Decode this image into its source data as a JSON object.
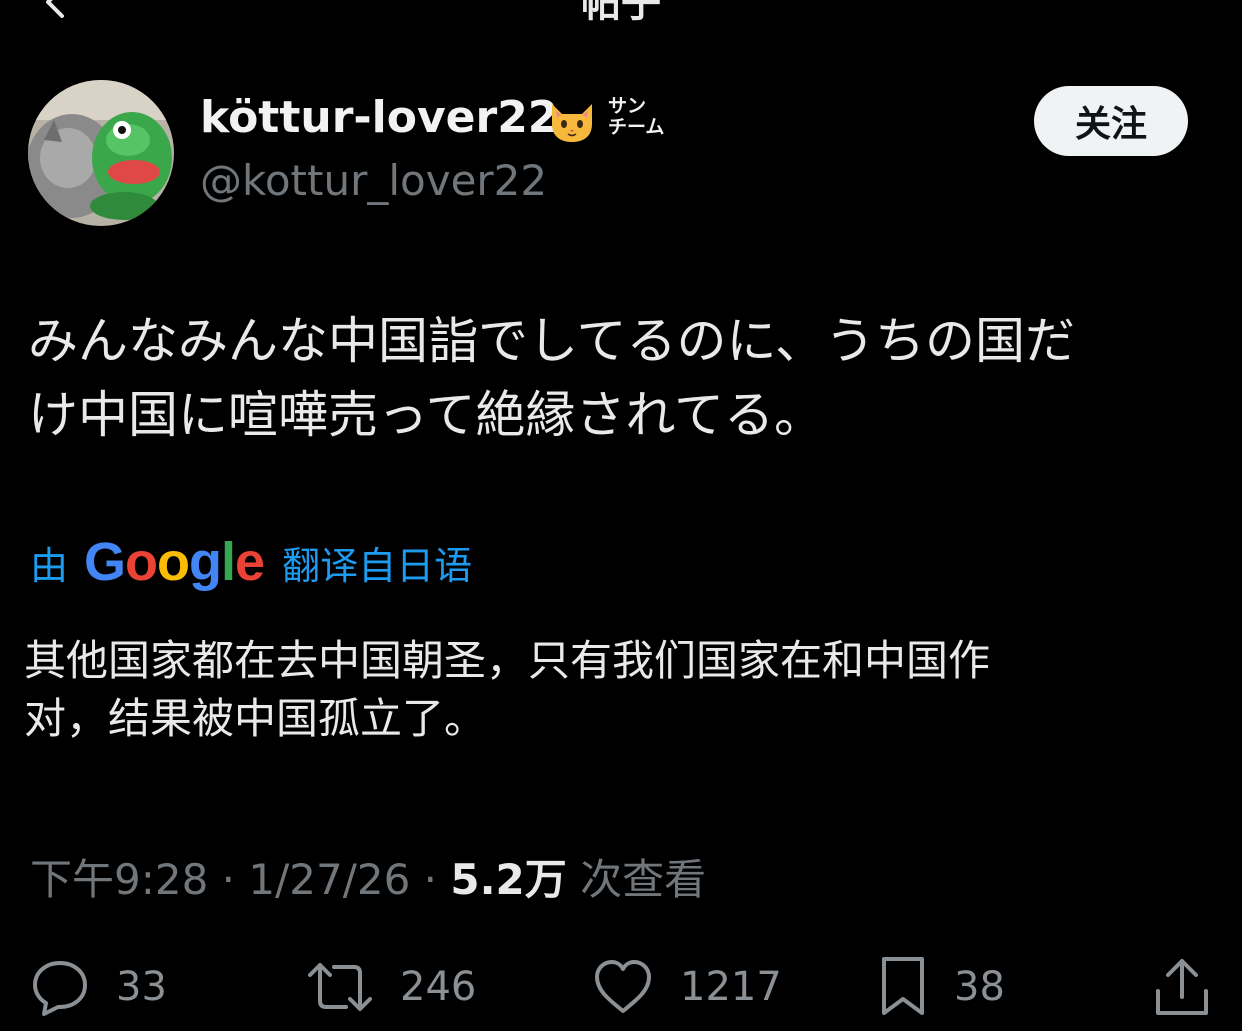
{
  "header": {
    "title": "帖子",
    "back_icon": "chevron-left-icon"
  },
  "author": {
    "display_name": "köttur-lover22",
    "badge_icon": "cat-face-icon",
    "badge_text": "サン\nチーム",
    "handle": "@kottur_lover22",
    "avatar": "avatar-cat-and-frog-plush"
  },
  "follow_label": "关注",
  "post": {
    "text": "みんなみんな中国詣でしてるのに、うちの国だ\nけ中国に喧嘩売って絶縁されてる。"
  },
  "translation": {
    "by": "由",
    "provider": "Google",
    "from": "翻译自日语",
    "text": "其他国家都在去中国朝圣，只有我们国家在和中国作\n对，结果被中国孤立了。"
  },
  "meta": {
    "time": "下午9:28",
    "sep1": " · ",
    "date": "1/27/26",
    "sep2": " · ",
    "views_count": "5.2万",
    "views_label": " 次查看"
  },
  "actions": {
    "replies": "33",
    "reposts": "246",
    "likes": "1217",
    "bookmarks": "38"
  },
  "colors": {
    "background": "#000000",
    "text": "#e7e9ea",
    "secondary": "#71767b",
    "link": "#1d9bf0",
    "follow_bg": "#eff3f4",
    "google_blue": "#4285f4",
    "google_red": "#ea4335",
    "google_yellow": "#fbbc05",
    "google_green": "#34a853"
  }
}
